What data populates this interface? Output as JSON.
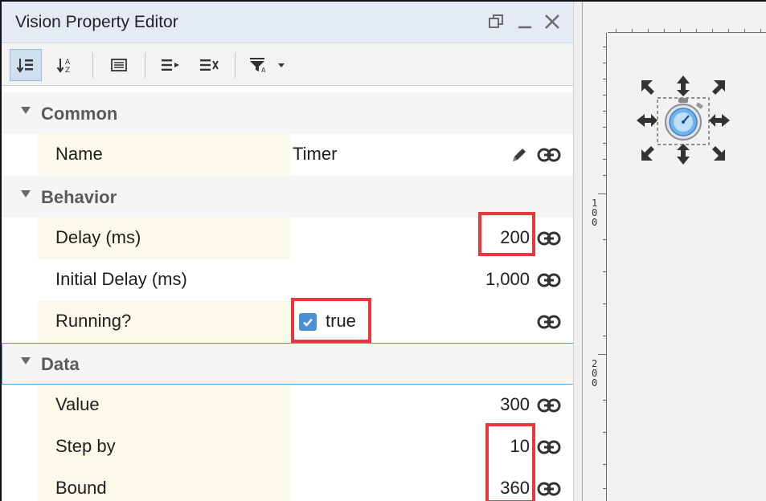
{
  "panel": {
    "title": "Vision Property Editor",
    "window_controls": [
      "restore-icon",
      "minimize-icon",
      "close-icon"
    ]
  },
  "toolbar": {
    "buttons": [
      {
        "icon": "sort-categorized-icon",
        "active": true
      },
      {
        "icon": "sort-alphabetical-icon",
        "active": false
      },
      {
        "icon": "property-list-icon",
        "active": false
      },
      {
        "icon": "expand-all-icon",
        "active": false
      },
      {
        "icon": "collapse-all-icon",
        "active": false
      },
      {
        "icon": "filter-icon",
        "active": false
      },
      {
        "icon": "dropdown-arrow-icon",
        "active": false
      }
    ]
  },
  "categories": {
    "common": "Common",
    "behavior": "Behavior",
    "data": "Data"
  },
  "properties": {
    "name": {
      "label": "Name",
      "value": "Timer"
    },
    "delay": {
      "label": "Delay (ms)",
      "value": "200"
    },
    "initial_delay": {
      "label": "Initial Delay (ms)",
      "value": "1,000"
    },
    "running": {
      "label": "Running?",
      "value": "true",
      "checked": true
    },
    "value": {
      "label": "Value",
      "value": "300"
    },
    "step_by": {
      "label": "Step by",
      "value": "10"
    },
    "bound": {
      "label": "Bound",
      "value": "360"
    }
  },
  "canvas": {
    "ruler_marks": [
      "1\n0\n0",
      "2\n0\n0"
    ],
    "component_icon": "stopwatch-icon"
  },
  "colors": {
    "highlight": "#e8383d",
    "accent": "#4a90d9",
    "name_cell_bg": "#fbf9ea"
  }
}
